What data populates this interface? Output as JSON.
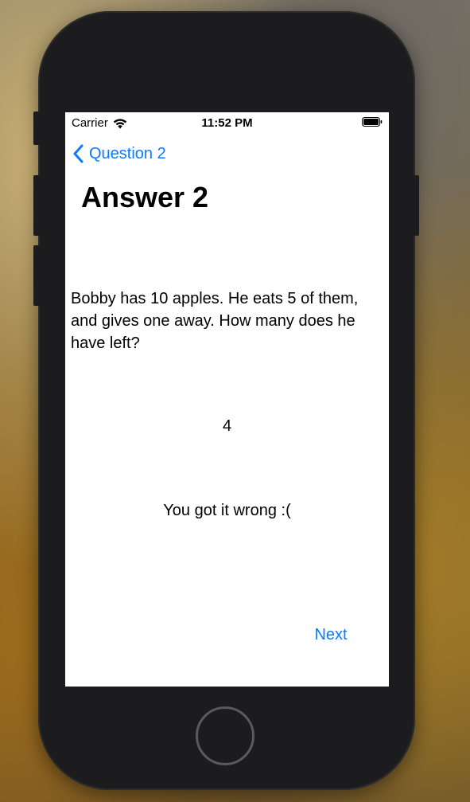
{
  "status_bar": {
    "carrier": "Carrier",
    "time": "11:52 PM",
    "wifi_icon": "wifi-icon",
    "battery_icon": "battery-full-icon"
  },
  "nav": {
    "back_label": "Question 2",
    "back_icon": "chevron-left-icon"
  },
  "page": {
    "title": "Answer 2",
    "question": "Bobby has 10 apples. He eats 5 of them, and gives one away. How many does he have left?",
    "given_answer": "4",
    "result": "You got it wrong :(",
    "next_label": "Next"
  },
  "colors": {
    "accent": "#0a7aff",
    "device_body": "#1c1c1e",
    "screen_bg": "#ffffff"
  }
}
